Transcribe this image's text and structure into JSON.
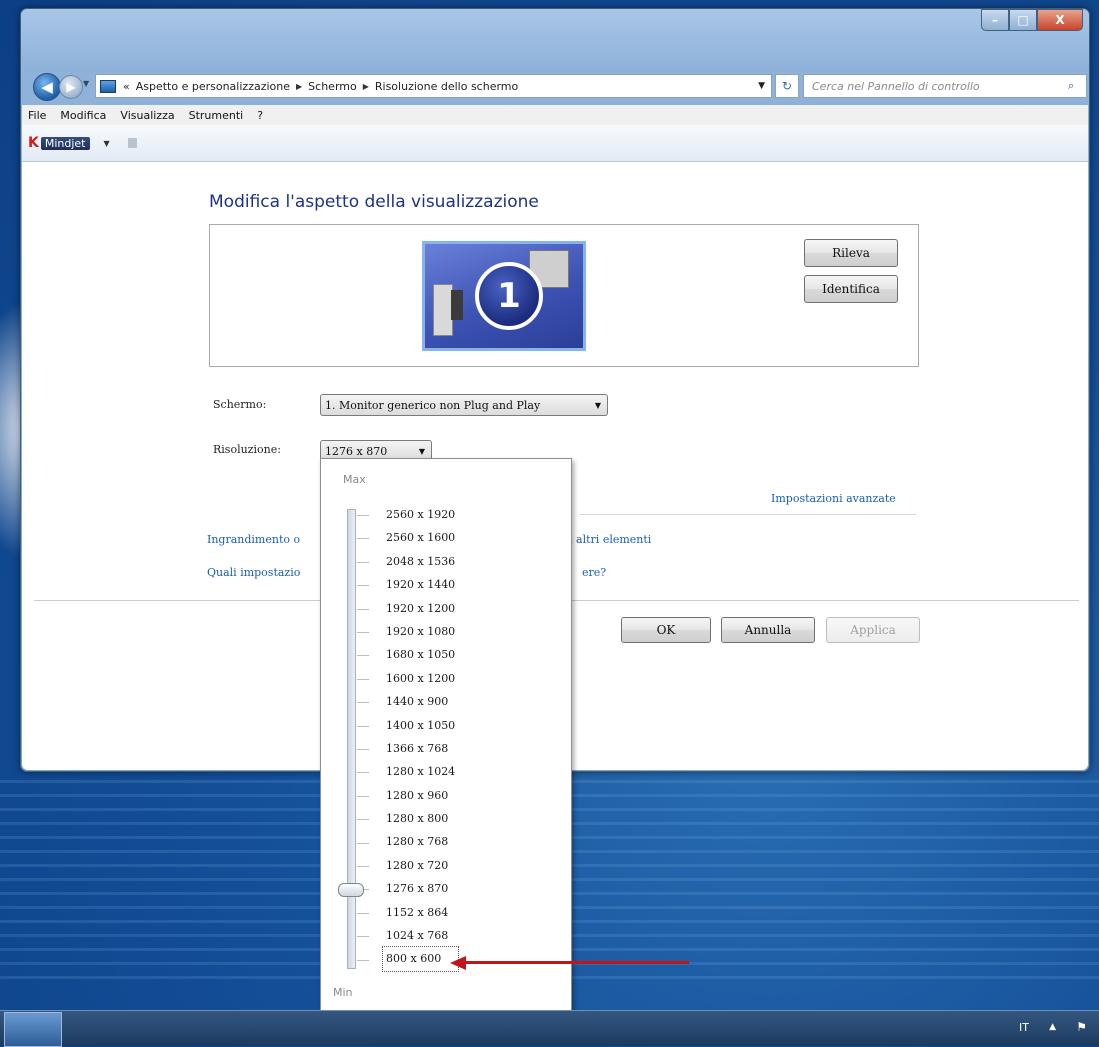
{
  "window": {
    "controls": {
      "minimize": "–",
      "maximize": "□",
      "close": "X"
    }
  },
  "nav": {
    "back_glyph": "◀",
    "forward_glyph": "▶",
    "history_glyph": "▼",
    "address_prefix": "«",
    "breadcrumb": [
      "Aspetto e personalizzazione",
      "Schermo",
      "Risoluzione dello schermo"
    ],
    "address_dropdown": "▼",
    "refresh_glyph": "↻",
    "search_placeholder": "Cerca nel Pannello di controllo",
    "search_glyph": "⌕"
  },
  "menubar": [
    "File",
    "Modifica",
    "Visualizza",
    "Strumenti",
    "?"
  ],
  "toolbar": {
    "logo_mark": "K",
    "logo_text": "Mindjet",
    "drop": "▼"
  },
  "page": {
    "title": "Modifica l'aspetto della visualizzazione",
    "monitor_number": "1",
    "detect_label": "Rileva",
    "identify_label": "Identifica",
    "screen_label": "Schermo:",
    "screen_value": "1. Monitor generico non Plug and Play",
    "resolution_label": "Risoluzione:",
    "resolution_value": "1276 x 870",
    "advanced_link": "Impostazioni avanzate",
    "link_enlarge_start": "Ingrandimento o",
    "link_enlarge_end": "di altri elementi",
    "link_which_start": "Quali impostazio",
    "link_which_end": "ere?",
    "ok_label": "OK",
    "cancel_label": "Annulla",
    "apply_label": "Applica"
  },
  "resolution_dropdown": {
    "max_label": "Max",
    "min_label": "Min",
    "items": [
      "2560 x 1920",
      "2560 x 1600",
      "2048 x 1536",
      "1920 x 1440",
      "1920 x 1200",
      "1920 x 1080",
      "1680 x 1050",
      "1600 x 1200",
      "1440 x 900",
      "1400 x 1050",
      "1366 x 768",
      "1280 x 1024",
      "1280 x 960",
      "1280 x 800",
      "1280 x 768",
      "1280 x 720",
      "1276 x 870",
      "1152 x 864",
      "1024 x 768",
      "800 x 600"
    ],
    "slider_selected_index": 16,
    "highlighted_item": "800 x 600",
    "annotation_arrow_color": "#c0161a"
  },
  "taskbar": {
    "language": "IT",
    "tray_up": "▲",
    "flag_glyph": "⚑"
  }
}
